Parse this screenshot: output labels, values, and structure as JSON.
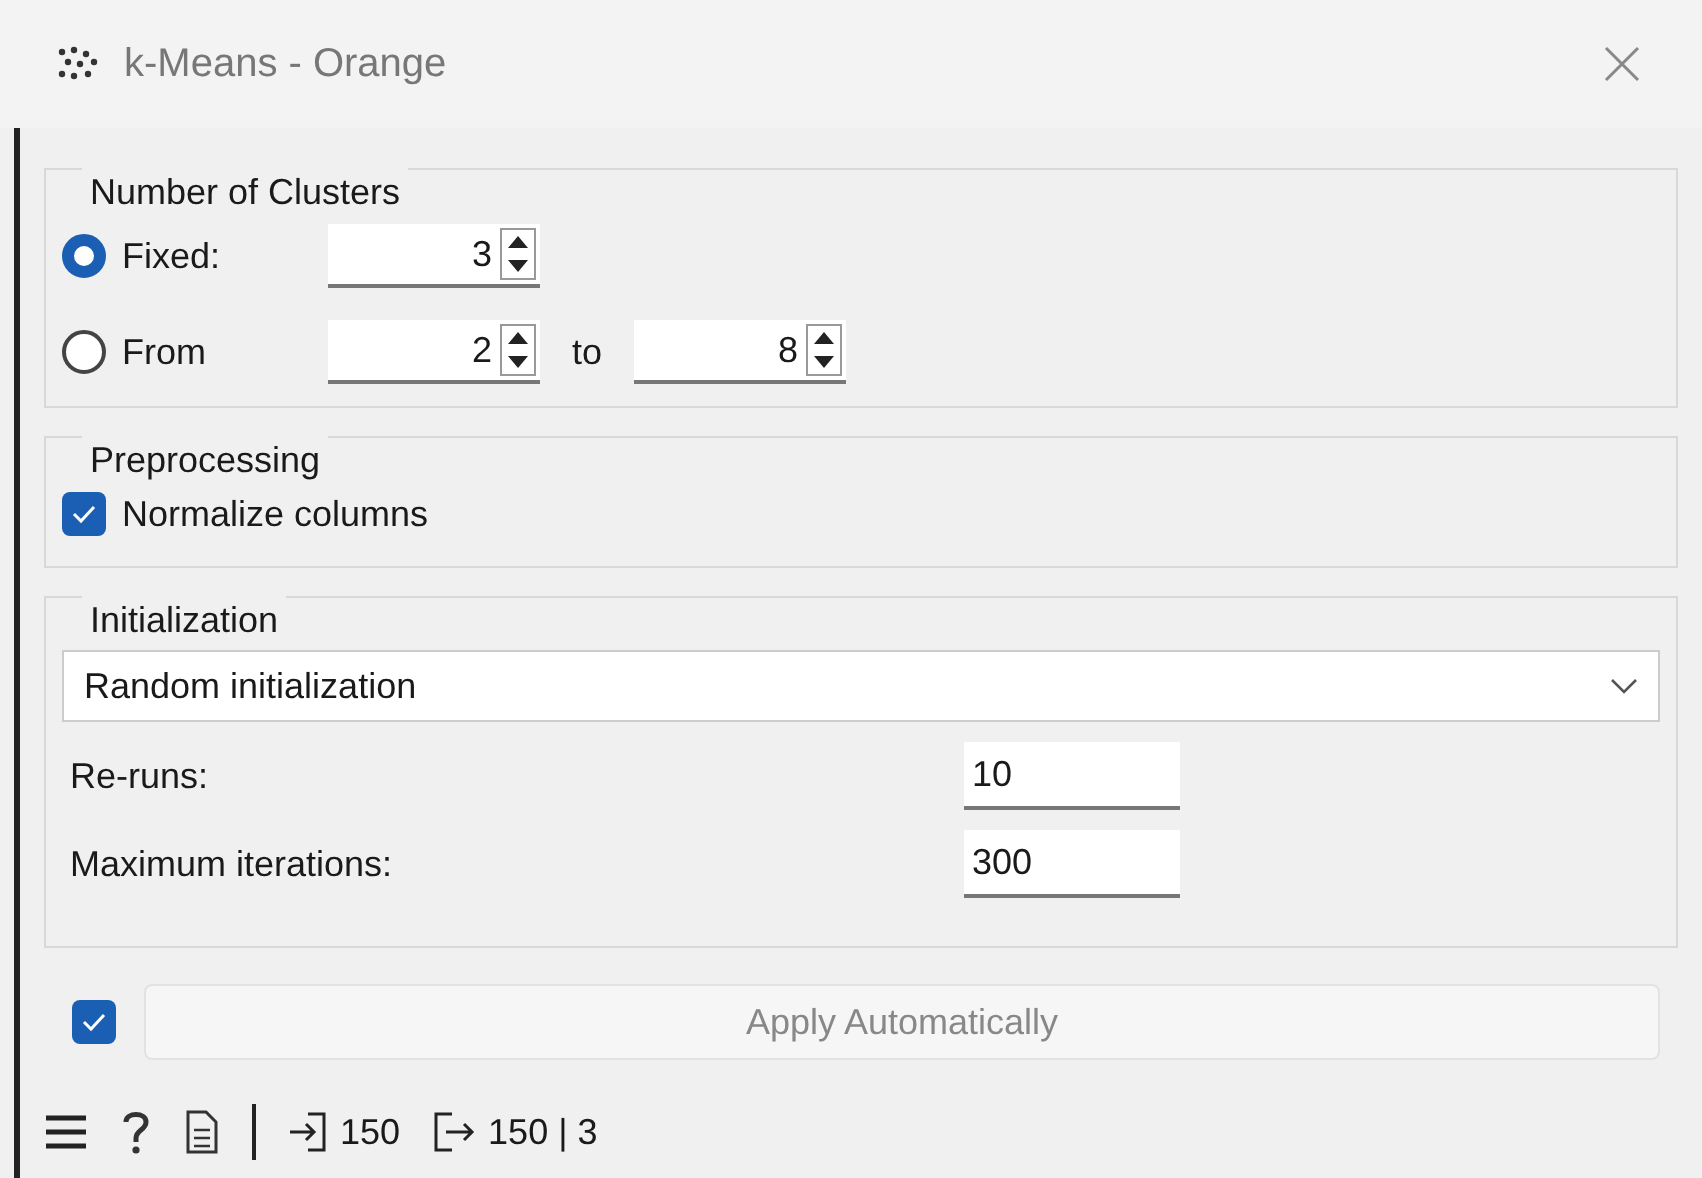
{
  "window": {
    "title": "k-Means - Orange"
  },
  "clusters": {
    "title": "Number of Clusters",
    "fixed": {
      "label": "Fixed:",
      "selected": true,
      "value": "3"
    },
    "range": {
      "label": "From",
      "selected": false,
      "from": "2",
      "to_label": "to",
      "to": "8"
    }
  },
  "preprocessing": {
    "title": "Preprocessing",
    "normalize": {
      "label": "Normalize columns",
      "checked": true
    }
  },
  "initialization": {
    "title": "Initialization",
    "method": "Random initialization",
    "fields": [
      {
        "label": "Re-runs:",
        "value": "10"
      },
      {
        "label": "Maximum iterations:",
        "value": "300"
      }
    ]
  },
  "apply": {
    "checked": true,
    "label": "Apply Automatically"
  },
  "status_bar": {
    "input": "150",
    "output": "150 | 3"
  }
}
